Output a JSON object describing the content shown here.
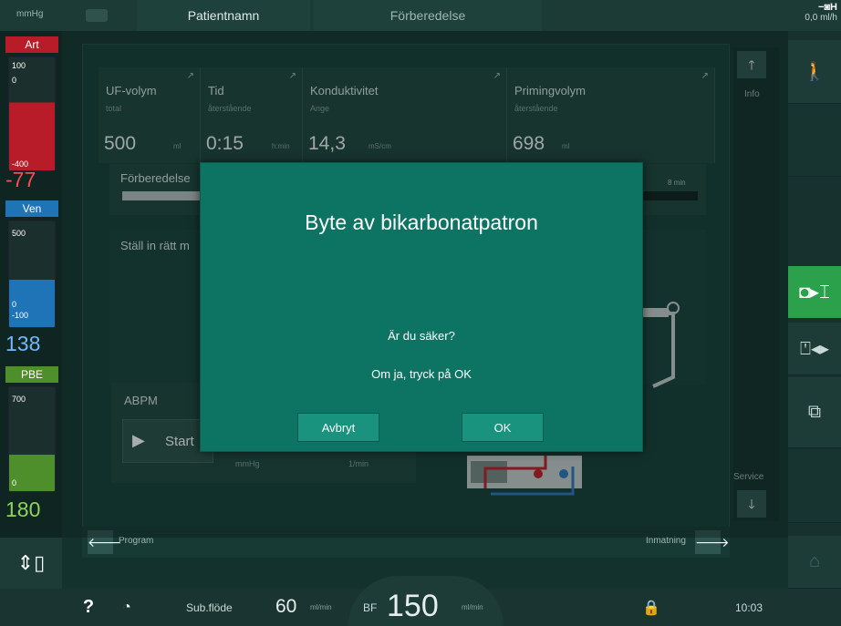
{
  "topbar": {
    "unit": "mmHg",
    "tab_patient": "Patientnamn",
    "tab_phase": "Förberedelse",
    "uf_value": "0,0",
    "uf_unit": "ml/h"
  },
  "pressures": {
    "art": {
      "label": "Art",
      "scale_top": "100",
      "scale_zero": "0",
      "scale_bottom": "-400",
      "value": "-77"
    },
    "ven": {
      "label": "Ven",
      "scale_top": "500",
      "scale_zero": "0",
      "scale_bottom": "-100",
      "value": "138"
    },
    "pbe": {
      "label": "PBE",
      "scale_top": "700",
      "scale_zero": "0",
      "value": "180"
    }
  },
  "cells": [
    {
      "title": "UF-volym",
      "sub": "total",
      "value": "500",
      "unit": "ml"
    },
    {
      "title": "Tid",
      "sub": "återstående",
      "value": "0:15",
      "unit": "h:min"
    },
    {
      "title": "Konduktivitet",
      "sub": "Ange",
      "value": "14,3",
      "unit": "mS/cm"
    },
    {
      "title": "Primingvolym",
      "sub": "återstående",
      "value": "698",
      "unit": "ml"
    }
  ],
  "progress": {
    "label": "Förberedelse",
    "remaining": "8 min"
  },
  "instruction": "Ställ in rätt m",
  "abpm": {
    "title": "ABPM",
    "start_label": "Start",
    "unit1": "mmHg",
    "unit2": "1/min"
  },
  "right": {
    "info_label": "Info",
    "service_label": "Service"
  },
  "nav": {
    "back_label": "Program",
    "forward_label": "Inmatning"
  },
  "bottom": {
    "help": "?",
    "subflow_label": "Sub.flöde",
    "subflow_value": "60",
    "subflow_unit": "ml/min",
    "bf_label": "BF",
    "bf_value": "150",
    "bf_unit": "ml/min",
    "time": "10:03"
  },
  "modal": {
    "title": "Byte av bikarbonatpatron",
    "question": "Är du säker?",
    "hint": "Om ja, tryck på OK",
    "cancel_label": "Avbryt",
    "ok_label": "OK"
  }
}
